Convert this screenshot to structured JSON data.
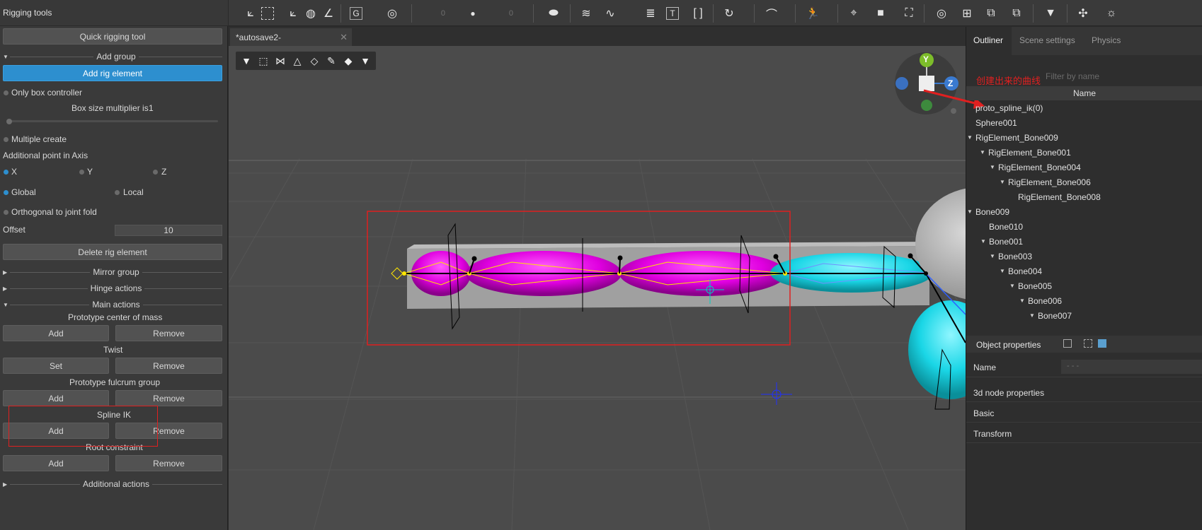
{
  "left_panel": {
    "title": "Rigging tools",
    "quick_rigging": "Quick rigging tool",
    "add_group": "Add group",
    "add_rig_element": "Add rig element",
    "only_box_controller": "Only box controller",
    "box_size_label": "Box size multiplier is",
    "box_size_value": "1",
    "multiple_create": "Multiple create",
    "additional_point": "Additional point in Axis",
    "axis_x": "X",
    "axis_y": "Y",
    "axis_z": "Z",
    "global": "Global",
    "local": "Local",
    "orthogonal": "Orthogonal to joint fold",
    "offset_label": "Offset",
    "offset_value": "10",
    "delete_rig_element": "Delete rig element",
    "mirror_group": "Mirror group",
    "hinge_actions": "Hinge actions",
    "main_actions": "Main actions",
    "proto_center": "Prototype center of mass",
    "twist": "Twist",
    "proto_fulcrum": "Prototype fulcrum group",
    "spline_ik": "Spline IK",
    "root_constraint": "Root constraint",
    "additional_actions": "Additional actions",
    "add": "Add",
    "remove": "Remove",
    "set": "Set"
  },
  "toolbar": {
    "num1": "0",
    "num2": "0"
  },
  "viewport": {
    "tab_title": "*autosave2-",
    "tab_close": "✕",
    "gizmo_y": "Y",
    "gizmo_z": "Z"
  },
  "right_panel": {
    "tabs": [
      "Outliner",
      "Scene settings",
      "Physics"
    ],
    "filter_placeholder": "Filter by name",
    "name_header": "Name",
    "annotation": "创建出来的曲线",
    "tree": [
      "proto_spline_ik(0)",
      "Sphere001",
      "RigElement_Bone009",
      "RigElement_Bone001",
      "RigElement_Bone004",
      "RigElement_Bone006",
      "RigElement_Bone008",
      "Bone009",
      "Bone010",
      "Bone001",
      "Bone003",
      "Bone004",
      "Bone005",
      "Bone006",
      "Bone007"
    ],
    "object_properties": "Object properties",
    "name_label": "Name",
    "name_value": "- - -",
    "node_props": "3d node properties",
    "basic": "Basic",
    "transform": "Transform"
  },
  "colors": {
    "accent": "#2d8fcf",
    "magenta": "#e600e6",
    "cyan": "#1ad6e6",
    "highlight": "#e02020"
  }
}
